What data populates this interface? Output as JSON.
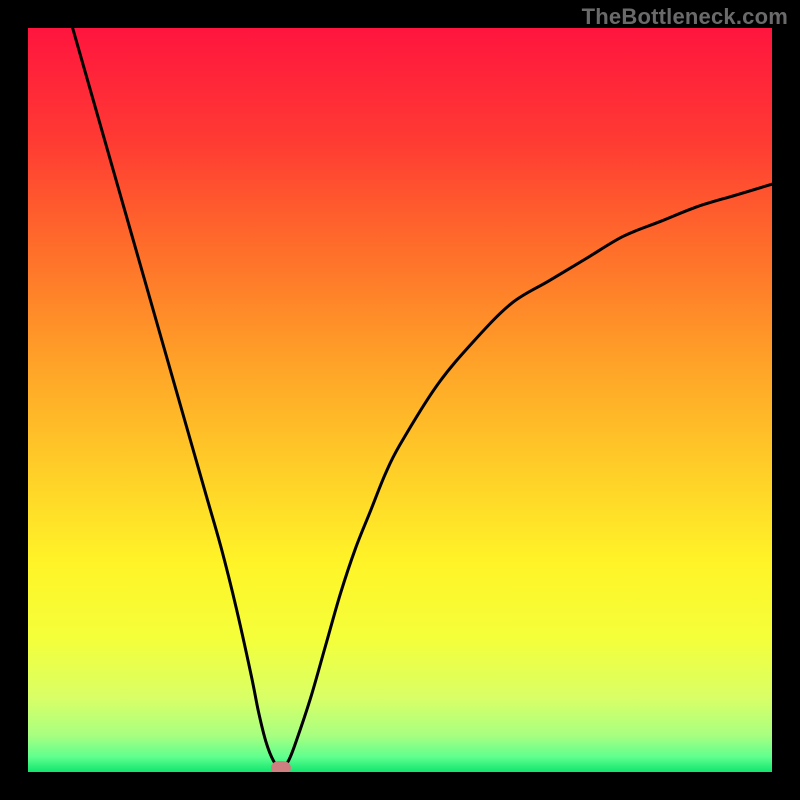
{
  "watermark": "TheBottleneck.com",
  "chart_data": {
    "type": "line",
    "title": "",
    "xlabel": "",
    "ylabel": "",
    "xlim": [
      0,
      100
    ],
    "ylim": [
      0,
      100
    ],
    "grid": false,
    "legend": false,
    "series": [
      {
        "name": "bottleneck-curve",
        "x": [
          6,
          8,
          10,
          12,
          14,
          16,
          18,
          20,
          22,
          24,
          26,
          28,
          30,
          31,
          32,
          33,
          34,
          35,
          36,
          38,
          40,
          42,
          44,
          46,
          48,
          50,
          55,
          60,
          65,
          70,
          75,
          80,
          85,
          90,
          95,
          100
        ],
        "y": [
          100,
          93,
          86,
          79,
          72,
          65,
          58,
          51,
          44,
          37,
          30,
          22,
          13,
          8,
          4,
          1.5,
          0.5,
          1.5,
          4,
          10,
          17,
          24,
          30,
          35,
          40,
          44,
          52,
          58,
          63,
          66,
          69,
          72,
          74,
          76,
          77.5,
          79
        ]
      }
    ],
    "marker": {
      "x": 34,
      "y": 0.5,
      "color": "#cf7f7f"
    },
    "gradient_bands": [
      {
        "y": 100,
        "color": "#ff153e"
      },
      {
        "y": 85,
        "color": "#ff3a33"
      },
      {
        "y": 70,
        "color": "#ff6f2a"
      },
      {
        "y": 55,
        "color": "#ffa228"
      },
      {
        "y": 40,
        "color": "#ffd028"
      },
      {
        "y": 28,
        "color": "#fff428"
      },
      {
        "y": 18,
        "color": "#f4ff3a"
      },
      {
        "y": 10,
        "color": "#d9ff66"
      },
      {
        "y": 5,
        "color": "#a9ff80"
      },
      {
        "y": 2,
        "color": "#5fff8e"
      },
      {
        "y": 0,
        "color": "#11e56f"
      }
    ]
  }
}
